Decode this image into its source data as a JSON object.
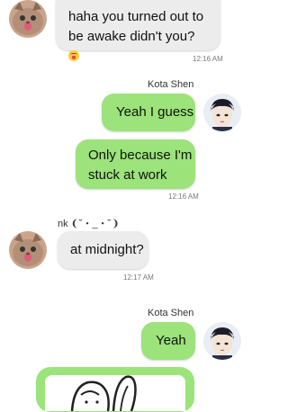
{
  "messages": [
    {
      "text": "haha you turned out to be awake didn't you?",
      "emoji": "tongue-wink-emoji",
      "time": "12:16 AM"
    },
    {
      "sender": "Kota Shen",
      "text": "Yeah I guess"
    },
    {
      "text": "Only because I'm stuck at work",
      "time": "12:16 AM"
    },
    {
      "sender": "nk ❨˘・_・˘❩",
      "text": "at midnight?",
      "time": "12:17 AM"
    },
    {
      "sender": "Kota Shen",
      "text": "Yeah"
    }
  ],
  "icons": {
    "other_avatar": "cat-avatar",
    "self_avatar": "anime-boy-avatar",
    "sticker": "cartoon-sticker"
  },
  "colors": {
    "green_bubble": "#9be37a",
    "grey_bubble": "#ececec"
  }
}
